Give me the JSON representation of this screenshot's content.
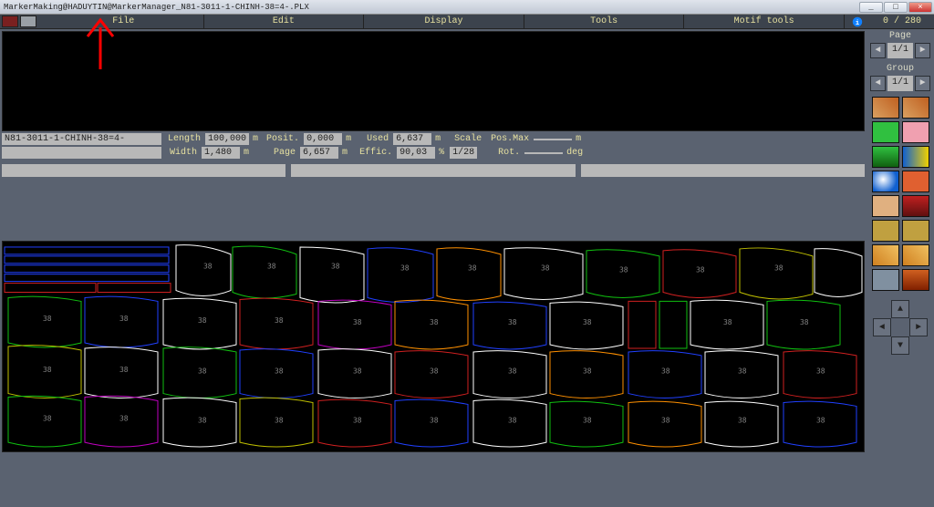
{
  "window": {
    "title": "MarkerMaking@HADUYTIN@MarkerManager_N81-3011-1-CHINH-38=4-.PLX",
    "min": "_",
    "max": "□",
    "close": "×"
  },
  "menu": {
    "file": "File",
    "edit": "Edit",
    "display": "Display",
    "tools": "Tools",
    "motif": "Motif tools",
    "counter": "0 / 280"
  },
  "info": {
    "name": "N81-3011-1-CHINH-38=4-",
    "length_lbl": "Length",
    "length": "100,000",
    "length_u": "m",
    "width_lbl": "Width",
    "width": "1,480",
    "width_u": "m",
    "posit_lbl": "Posit.",
    "posit": "0,000",
    "posit_u": "m",
    "page_lbl": "Page",
    "page": "6,657",
    "page_u": "m",
    "used_lbl": "Used",
    "used": "6,637",
    "used_u": "m",
    "effic_lbl": "Effic.",
    "effic": "90,03",
    "effic_u": "%",
    "scale_lbl": "Scale",
    "scale": "1/28",
    "posmax_lbl": "Pos.Max",
    "posmax": "",
    "posmax_u": "m",
    "rot_lbl": "Rot.",
    "rot": "",
    "rot_u": "deg"
  },
  "side": {
    "page_lbl": "Page",
    "page_val": "1/1",
    "group_lbl": "Group",
    "group_val": "1/1",
    "left": "◄",
    "right": "►",
    "up": "▲",
    "down": "▼"
  },
  "pieces": {
    "label": "38"
  }
}
